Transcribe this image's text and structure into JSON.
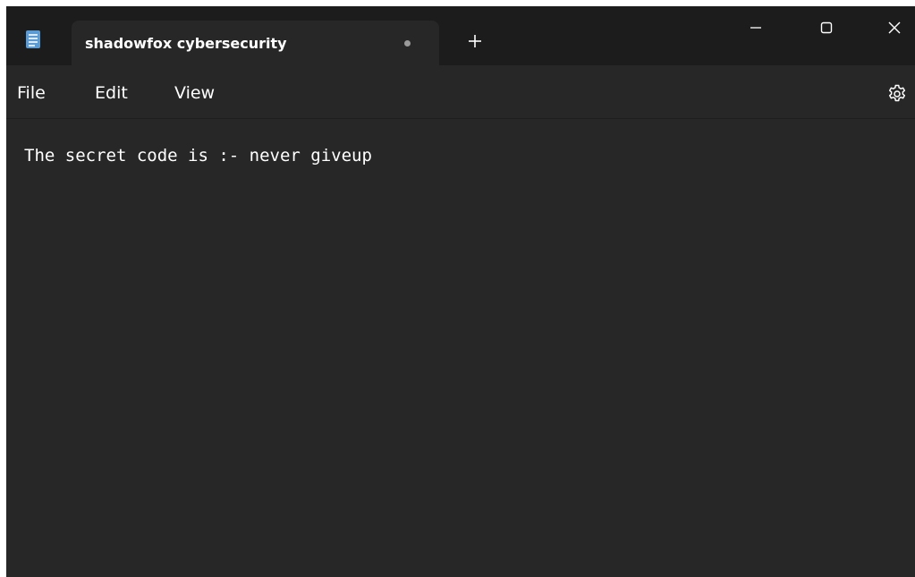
{
  "window": {
    "tab_title": "shadowfox cybersecurity",
    "new_tab_symbol": "+",
    "unsaved_indicator": "•"
  },
  "icons": {
    "app": "notepad-icon",
    "new_tab": "plus-icon",
    "minimize": "minimize-icon",
    "maximize": "maximize-icon",
    "close": "close-icon",
    "settings": "gear-icon"
  },
  "menu": {
    "items": [
      {
        "label": "File"
      },
      {
        "label": "Edit"
      },
      {
        "label": "View"
      }
    ]
  },
  "editor": {
    "content": "The secret code is :- never giveup"
  },
  "colors": {
    "titlebar_bg": "#1c1c1c",
    "editor_bg": "#272727",
    "text": "#ffffff",
    "app_icon": "#5b9bd5"
  }
}
